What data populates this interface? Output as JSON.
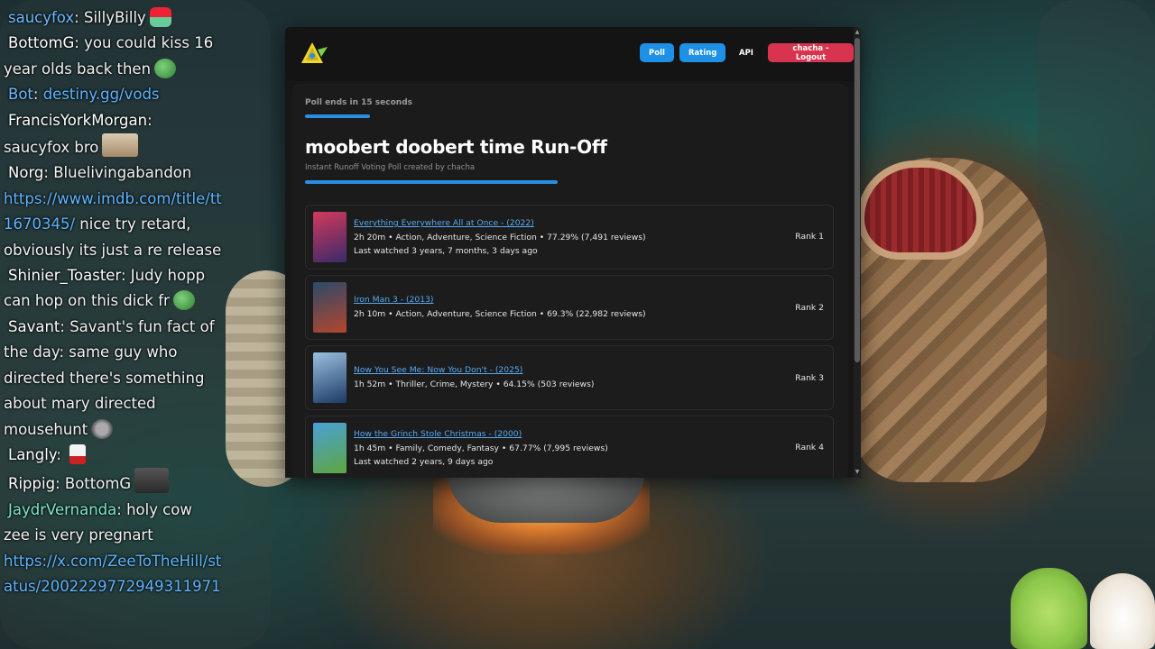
{
  "chat": [
    {
      "user": "saucyfox",
      "text": "SillyBilly",
      "emote": "hat",
      "cls": "u-blue"
    },
    {
      "user": "BottomG",
      "text": "you could kiss 16 year olds back then",
      "emote": "pepe",
      "cls": "u-white"
    },
    {
      "user": "Bot",
      "text": "destiny.gg/vods",
      "emote": "",
      "cls": "u-blue",
      "link": true
    },
    {
      "user": "FrancisYorkMorgan",
      "text": "saucyfox bro",
      "emote": "cat",
      "cls": "u-white"
    },
    {
      "user": "Norg",
      "text": "Bluelivingabandon",
      "emote": "",
      "cls": "u-white"
    },
    {
      "user": "",
      "text": "https://www.imdb.com/title/tt1670345/",
      "emote": "",
      "cls": "u-white",
      "link": true,
      "after": " nice try retard, obviously its just a re release"
    },
    {
      "user": "Shinier_Toaster",
      "text": "Judy hopp can hop on this dick fr",
      "emote": "pepe",
      "cls": "u-white"
    },
    {
      "user": "Savant",
      "text": "Savant's fun fact of the day: same guy who directed there's something about mary directed mousehunt",
      "emote": "ghost",
      "cls": "u-white"
    },
    {
      "user": "Langly",
      "text": "",
      "emote": "cup",
      "cls": "u-white"
    },
    {
      "user": "Rippig",
      "text": "BottomG",
      "emote": "face",
      "cls": "u-white"
    },
    {
      "user": "JaydrVernanda",
      "text": "holy cow zee is very pregnart",
      "emote": "",
      "cls": "u-green"
    },
    {
      "user": "",
      "text": "https://x.com/ZeeToTheHill/status/2002229772949311971",
      "emote": "",
      "cls": "u-white",
      "link": true
    }
  ],
  "nav": {
    "poll": "Poll",
    "rating": "Rating",
    "api": "API",
    "logout": "chacha - Logout"
  },
  "poll": {
    "ends": "Poll ends in 15 seconds",
    "title": "moobert doobert time Run-Off",
    "subtitle": "Instant Runoff Voting Poll created by chacha"
  },
  "movies": [
    {
      "title": "Everything Everywhere All at Once - (2022)",
      "meta": "2h 20m • Action, Adventure, Science Fiction • 77.29% (7,491 reviews)",
      "watched": "Last watched 3 years, 7 months, 3 days ago",
      "rank": "Rank 1",
      "poster": [
        "#d23a5a",
        "#3a2a6a"
      ]
    },
    {
      "title": "Iron Man 3 - (2013)",
      "meta": "2h 10m • Action, Adventure, Science Fiction • 69.3% (22,982 reviews)",
      "watched": "",
      "rank": "Rank 2",
      "poster": [
        "#2b4a6a",
        "#b5462c"
      ]
    },
    {
      "title": "Now You See Me: Now You Don't - (2025)",
      "meta": "1h 52m • Thriller, Crime, Mystery • 64.15% (503 reviews)",
      "watched": "",
      "rank": "Rank 3",
      "poster": [
        "#9cc0e0",
        "#1b3a66"
      ]
    },
    {
      "title": "How the Grinch Stole Christmas - (2000)",
      "meta": "1h 45m • Family, Comedy, Fantasy • 67.77% (7,995 reviews)",
      "watched": "Last watched 2 years, 9 days ago",
      "rank": "Rank 4",
      "poster": [
        "#4aa0d8",
        "#5ea640"
      ]
    }
  ],
  "colors": {
    "accent": "#1e90e6",
    "logout": "#d8344f",
    "link": "#58a8ef"
  }
}
